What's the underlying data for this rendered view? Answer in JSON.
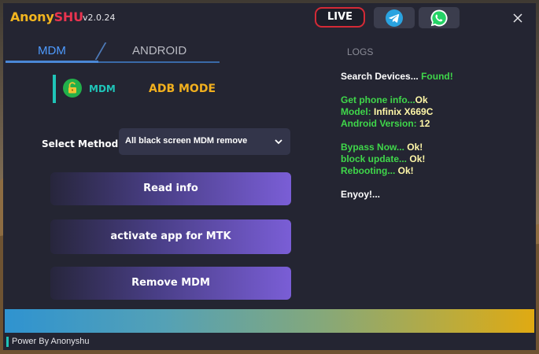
{
  "app": {
    "brand_primary": "Anony",
    "brand_secondary": "SHU",
    "version": "v2.0.24"
  },
  "titlebar": {
    "live_label": "LIVE",
    "telegram_icon": "telegram-icon",
    "whatsapp_icon": "whatsapp-icon",
    "close_icon": "close-icon"
  },
  "tabs": [
    {
      "label": "MDM",
      "active": true
    },
    {
      "label": "ANDROID",
      "active": false
    }
  ],
  "modes": {
    "mdm_label": "MDM",
    "mdm_icon": "lock-open-icon",
    "adb_label": "ADB MODE"
  },
  "method": {
    "label": "Select Method:",
    "selected": "All black screen MDM remove"
  },
  "actions": {
    "read_info": "Read info",
    "activate_mtk": "activate app for MTK",
    "remove_mdm": "Remove MDM"
  },
  "logs": {
    "title": "LOGS",
    "search_devices": "Search Devices...",
    "found": "Found!",
    "get_phone_info": "Get phone info...",
    "ok": "Ok",
    "model_label": "Model:",
    "model_value": "Infinix X669C",
    "android_version_label": "Android Version:",
    "android_version_value": "12",
    "bypass_now": "Bypass Now...",
    "ok_bang": "Ok!",
    "block_update": "block update...",
    "rebooting": "Rebooting...",
    "enjoy": "Enyoy!..."
  },
  "status": {
    "text": "Power By Anonyshu"
  },
  "colors": {
    "window_bg": "#242532",
    "accent_blue": "#4e9bff",
    "accent_teal": "#1fc4b8",
    "accent_gold": "#f2b01e",
    "live_border": "#d42a36",
    "log_green": "#3fd74a",
    "log_yellow": "#f3f05a"
  }
}
